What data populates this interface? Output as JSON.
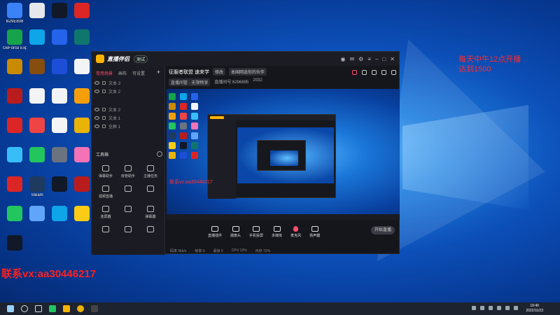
{
  "desktop": {
    "icons": [
      {
        "label": "B29E808",
        "color": "#3b82f6"
      },
      {
        "label": "",
        "color": "#e5e7eb"
      },
      {
        "label": "",
        "color": "#111827"
      },
      {
        "label": "",
        "color": "#dc2626"
      },
      {
        "label": "GeForce Experience",
        "color": "#16a34a"
      },
      {
        "label": "",
        "color": "#0ea5e9"
      },
      {
        "label": "",
        "color": "#2563eb"
      },
      {
        "label": "",
        "color": "#0f766e"
      },
      {
        "label": "",
        "color": "#ca8a04"
      },
      {
        "label": "",
        "color": "#854d0e"
      },
      {
        "label": "",
        "color": "#1d4ed8"
      },
      {
        "label": "",
        "color": "#f3f4f6"
      },
      {
        "label": "",
        "color": "#b91c1c"
      },
      {
        "label": "",
        "color": "#f3f4f6"
      },
      {
        "label": "",
        "color": "#f3f4f6"
      },
      {
        "label": "",
        "color": "#f59e0b"
      },
      {
        "label": "",
        "color": "#dc2626"
      },
      {
        "label": "",
        "color": "#ef4444"
      },
      {
        "label": "",
        "color": "#f3f4f6"
      },
      {
        "label": "",
        "color": "#eab308"
      },
      {
        "label": "",
        "color": "#38bdf8"
      },
      {
        "label": "",
        "color": "#22c55e"
      },
      {
        "label": "",
        "color": "#6b7280"
      },
      {
        "label": "",
        "color": "#f472b6"
      },
      {
        "label": "",
        "color": "#dc2626"
      },
      {
        "label": "Steam",
        "color": "#1e3a5f"
      },
      {
        "label": "",
        "color": "#111827"
      },
      {
        "label": "",
        "color": "#b91c1c"
      },
      {
        "label": "",
        "color": "#22c55e"
      },
      {
        "label": "",
        "color": "#60a5fa"
      },
      {
        "label": "",
        "color": "#0ea5e9"
      },
      {
        "label": "",
        "color": "#facc15"
      },
      {
        "label": "",
        "color": "#111827"
      }
    ],
    "overlay_text_line1": "每天中午12点开播",
    "overlay_text_line2": "达到1500",
    "wechat_text": "联系vx:aa30446217"
  },
  "app": {
    "name": "直播伴侣",
    "badge": "测试",
    "tabs": [
      "常用场景",
      "画布",
      "可设置"
    ],
    "scenes": [
      "文本 3",
      "文本 2",
      "文本 2",
      "文本 1",
      "全屏 1"
    ],
    "tools_header": "工具箱",
    "tools": [
      "弹幕助手",
      "房管助手",
      "主播任务",
      "视频直播",
      "",
      "",
      "连屏器",
      "",
      "弹幕器",
      "",
      "",
      ""
    ],
    "stream_title": "征服者联盟 速来学",
    "stream_tag": "修改",
    "stream_notice": "本国网选你的伙伴",
    "room_line": "直播间管 · 无限畅享",
    "room_info": "直播间号:6296895",
    "room_count": "2032",
    "controls": [
      "直播插件",
      "摄像头",
      "手机投屏",
      "多媒体",
      "麦克风",
      "扬声器"
    ],
    "start_label": "开始直播",
    "status": [
      "码率 0kb/s",
      "帧率 0",
      "丢帧 0",
      "CPU 13%",
      "内存 72%"
    ],
    "preview_overlay_text": "联系vx:aa30446217"
  },
  "taskbar": {
    "time": "19:40",
    "date": "2022/11/23"
  }
}
